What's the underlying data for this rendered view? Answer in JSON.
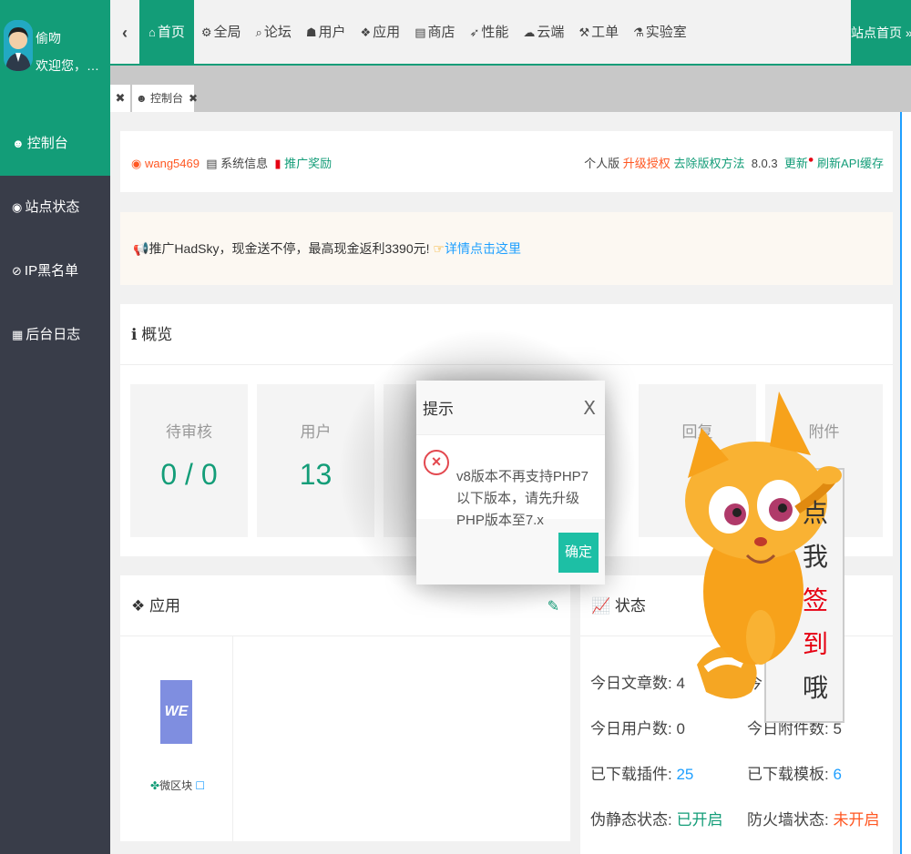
{
  "user": {
    "name": "偷吻",
    "greeting": "欢迎您，超级管理员"
  },
  "nav": {
    "collapse_icon": "chevron-left-icon",
    "items": [
      {
        "icon": "home-icon",
        "label": "首页"
      },
      {
        "icon": "gear-icon",
        "label": "全局"
      },
      {
        "icon": "search-icon",
        "label": "论坛"
      },
      {
        "icon": "users-icon",
        "label": "用户"
      },
      {
        "icon": "cubes-icon",
        "label": "应用"
      },
      {
        "icon": "shop-icon",
        "label": "商店"
      },
      {
        "icon": "rocket-icon",
        "label": "性能"
      },
      {
        "icon": "cloud-icon",
        "label": "云端"
      },
      {
        "icon": "wrench-icon",
        "label": "工单"
      },
      {
        "icon": "flask-icon",
        "label": "实验室"
      }
    ],
    "site_home": "站点首页 »"
  },
  "tabs": {
    "close_all": "✖",
    "active": {
      "label": "控制台",
      "close": "✖"
    }
  },
  "sidebar": {
    "items": [
      {
        "icon": "dashboard-icon",
        "label": "控制台"
      },
      {
        "icon": "lock-icon",
        "label": "站点状态"
      },
      {
        "icon": "ban-icon",
        "label": "IP黑名单"
      },
      {
        "icon": "calendar-icon",
        "label": "后台日志"
      }
    ]
  },
  "infobar": {
    "username": "wang5469",
    "sysinfo": "系统信息",
    "promote": "推广奖励",
    "edition": "个人版",
    "upgrade": "升级授权",
    "remove_copyright": "去除版权方法",
    "version": "8.0.3",
    "update": "更新",
    "refresh_api": "刷新API缓存"
  },
  "promo": {
    "text": "推广HadSky，现金送不停，最高现金返利3390元!",
    "link": "详情点击这里"
  },
  "overview": {
    "title": "概览",
    "stats": [
      {
        "label": "待审核",
        "value": "0 / 0"
      },
      {
        "label": "用户",
        "value": "13"
      },
      {
        "label": "回复",
        "value": ""
      },
      {
        "label": "附件",
        "value": ""
      }
    ]
  },
  "apps": {
    "title": "应用",
    "logo_text": "WE",
    "app_name": "微区块",
    "app_status": "☐"
  },
  "status": {
    "title": "状态",
    "rows": [
      {
        "label": "今日文章数:",
        "value": "4"
      },
      {
        "label": "今",
        "value": ""
      },
      {
        "label": "今日用户数:",
        "value": "0"
      },
      {
        "label": "今日附件数:",
        "value": "5"
      },
      {
        "label": "已下载插件:",
        "value": "25"
      },
      {
        "label": "已下载模板:",
        "value": "6"
      },
      {
        "label": "伪静态状态:",
        "value": "已开启"
      },
      {
        "label": "防火墙状态:",
        "value": "未开启"
      }
    ]
  },
  "dialog": {
    "title": "提示",
    "close": "X",
    "message": "v8版本不再支持PHP7以下版本，请先升级PHP版本至7.x",
    "ok": "确定"
  },
  "mascot": {
    "sign_chars": [
      "点",
      "我",
      "签",
      "到",
      "哦"
    ]
  }
}
